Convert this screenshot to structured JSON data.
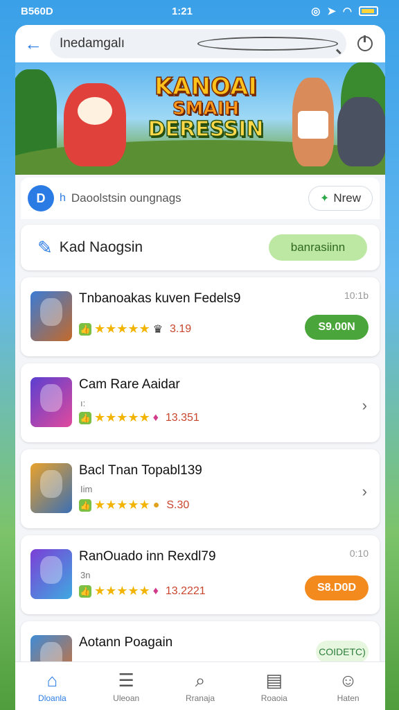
{
  "status": {
    "carrier": "B560D",
    "time": "1:21"
  },
  "search": {
    "value": "Inedamgalı"
  },
  "banner": {
    "line1": "KANOAI",
    "line2": "SMAIH",
    "line3": "DERESSIN"
  },
  "tabbar": {
    "chip": "D",
    "count": "h",
    "text": "Daoolstsin oungnags",
    "new_label": "Nrew"
  },
  "section": {
    "title": "Kad Naogsin",
    "action": "banrasiinn"
  },
  "items": [
    {
      "title": "Tnbanoakas kuven Fedels9",
      "sub": "",
      "rating": "3.19",
      "time": "10:1b",
      "price": "S9.00N",
      "price_color": "#4aa53a",
      "thumb_from": "#3a7bd5",
      "thumb_to": "#c46a2a"
    },
    {
      "title": "Cam Rare Aaidar",
      "sub": "ı:",
      "rating": "13.351",
      "time": "",
      "price": "",
      "thumb_from": "#5b3fd1",
      "thumb_to": "#e04a9c"
    },
    {
      "title": "Bacl Tnan Topabl139",
      "sub": "Iim",
      "rating": "S.30",
      "time": "",
      "price": "",
      "thumb_from": "#e9a22b",
      "thumb_to": "#3b6fb4"
    },
    {
      "title": "RanOuado inn Rexdl79",
      "sub": "3n",
      "rating": "13.2221",
      "time": "0:10",
      "price": "S8.D0D",
      "price_color": "#f38a1e",
      "thumb_from": "#7b3fd6",
      "thumb_to": "#3fa9e0"
    },
    {
      "title": "Aotann Poagain",
      "sub": "",
      "rating": "",
      "time": "",
      "price": "",
      "badge": "COIDETC)",
      "thumb_from": "#3f8bd6",
      "thumb_to": "#d9702b"
    }
  ],
  "nav": [
    {
      "label": "Dloanla",
      "icon": "home-icon"
    },
    {
      "label": "Uleoan",
      "icon": "menu-icon"
    },
    {
      "label": "Rranaja",
      "icon": "search-icon"
    },
    {
      "label": "Roaoia",
      "icon": "list-icon"
    },
    {
      "label": "Haten",
      "icon": "profile-icon"
    }
  ]
}
